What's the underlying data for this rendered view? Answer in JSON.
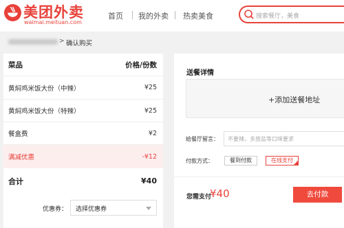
{
  "header": {
    "logo_text": "美团外卖",
    "logo_domain": "waimai.meituan.com",
    "nav": [
      "首页",
      "我的外卖",
      "热卖美食"
    ],
    "search_placeholder": "搜索餐厅，美食"
  },
  "breadcrumb": {
    "separator": ">",
    "current": "确认购买"
  },
  "order": {
    "header_item": "菜品",
    "header_price": "价格/份数",
    "items": [
      {
        "name": "黄焖鸡米饭大份（中辣）",
        "price": "¥25"
      },
      {
        "name": "黄焖鸡米饭大份（特辣）",
        "price": "¥25"
      },
      {
        "name": "餐盒费",
        "price": "¥2"
      }
    ],
    "discount": {
      "name": "满减优惠",
      "price": "-¥12"
    },
    "total": {
      "label": "合计",
      "value": "¥40"
    },
    "coupon": {
      "label": "优惠券：",
      "selected": "选择优惠券"
    }
  },
  "delivery": {
    "title": "送餐详情",
    "add_address": "+添加送餐地址",
    "message_label": "给餐厅留言：",
    "message_placeholder": "不要辣，多放盐等口味要求",
    "payment_label": "付款方式：",
    "payment_options": [
      {
        "label": "餐到付款",
        "selected": false
      },
      {
        "label": "在线支付",
        "selected": true
      }
    ],
    "pay_label": "您需支付",
    "pay_amount": "¥40",
    "pay_button": "去付款"
  },
  "icons": {
    "logo": "meituan-bowl-icon",
    "search": "search-icon",
    "coupon_dropdown": "chevron-down-icon",
    "selected_payment": "check-corner-icon"
  },
  "colors": {
    "brand": "#e8413a",
    "pay_button": "#f04a3d",
    "discount_row_bg": "#fdeeee",
    "page_bg": "#f1f1f1"
  }
}
